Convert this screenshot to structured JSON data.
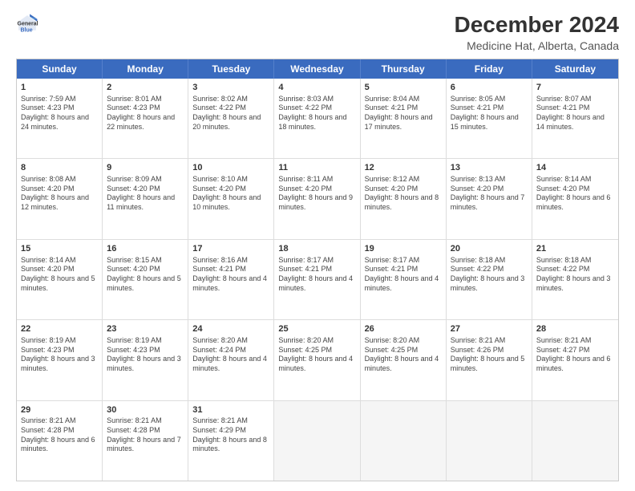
{
  "logo": {
    "line1": "General",
    "line2": "Blue"
  },
  "title": "December 2024",
  "subtitle": "Medicine Hat, Alberta, Canada",
  "days": [
    "Sunday",
    "Monday",
    "Tuesday",
    "Wednesday",
    "Thursday",
    "Friday",
    "Saturday"
  ],
  "weeks": [
    [
      {
        "num": "1",
        "sunrise": "Sunrise: 7:59 AM",
        "sunset": "Sunset: 4:23 PM",
        "daylight": "Daylight: 8 hours and 24 minutes."
      },
      {
        "num": "2",
        "sunrise": "Sunrise: 8:01 AM",
        "sunset": "Sunset: 4:23 PM",
        "daylight": "Daylight: 8 hours and 22 minutes."
      },
      {
        "num": "3",
        "sunrise": "Sunrise: 8:02 AM",
        "sunset": "Sunset: 4:22 PM",
        "daylight": "Daylight: 8 hours and 20 minutes."
      },
      {
        "num": "4",
        "sunrise": "Sunrise: 8:03 AM",
        "sunset": "Sunset: 4:22 PM",
        "daylight": "Daylight: 8 hours and 18 minutes."
      },
      {
        "num": "5",
        "sunrise": "Sunrise: 8:04 AM",
        "sunset": "Sunset: 4:21 PM",
        "daylight": "Daylight: 8 hours and 17 minutes."
      },
      {
        "num": "6",
        "sunrise": "Sunrise: 8:05 AM",
        "sunset": "Sunset: 4:21 PM",
        "daylight": "Daylight: 8 hours and 15 minutes."
      },
      {
        "num": "7",
        "sunrise": "Sunrise: 8:07 AM",
        "sunset": "Sunset: 4:21 PM",
        "daylight": "Daylight: 8 hours and 14 minutes."
      }
    ],
    [
      {
        "num": "8",
        "sunrise": "Sunrise: 8:08 AM",
        "sunset": "Sunset: 4:20 PM",
        "daylight": "Daylight: 8 hours and 12 minutes."
      },
      {
        "num": "9",
        "sunrise": "Sunrise: 8:09 AM",
        "sunset": "Sunset: 4:20 PM",
        "daylight": "Daylight: 8 hours and 11 minutes."
      },
      {
        "num": "10",
        "sunrise": "Sunrise: 8:10 AM",
        "sunset": "Sunset: 4:20 PM",
        "daylight": "Daylight: 8 hours and 10 minutes."
      },
      {
        "num": "11",
        "sunrise": "Sunrise: 8:11 AM",
        "sunset": "Sunset: 4:20 PM",
        "daylight": "Daylight: 8 hours and 9 minutes."
      },
      {
        "num": "12",
        "sunrise": "Sunrise: 8:12 AM",
        "sunset": "Sunset: 4:20 PM",
        "daylight": "Daylight: 8 hours and 8 minutes."
      },
      {
        "num": "13",
        "sunrise": "Sunrise: 8:13 AM",
        "sunset": "Sunset: 4:20 PM",
        "daylight": "Daylight: 8 hours and 7 minutes."
      },
      {
        "num": "14",
        "sunrise": "Sunrise: 8:14 AM",
        "sunset": "Sunset: 4:20 PM",
        "daylight": "Daylight: 8 hours and 6 minutes."
      }
    ],
    [
      {
        "num": "15",
        "sunrise": "Sunrise: 8:14 AM",
        "sunset": "Sunset: 4:20 PM",
        "daylight": "Daylight: 8 hours and 5 minutes."
      },
      {
        "num": "16",
        "sunrise": "Sunrise: 8:15 AM",
        "sunset": "Sunset: 4:20 PM",
        "daylight": "Daylight: 8 hours and 5 minutes."
      },
      {
        "num": "17",
        "sunrise": "Sunrise: 8:16 AM",
        "sunset": "Sunset: 4:21 PM",
        "daylight": "Daylight: 8 hours and 4 minutes."
      },
      {
        "num": "18",
        "sunrise": "Sunrise: 8:17 AM",
        "sunset": "Sunset: 4:21 PM",
        "daylight": "Daylight: 8 hours and 4 minutes."
      },
      {
        "num": "19",
        "sunrise": "Sunrise: 8:17 AM",
        "sunset": "Sunset: 4:21 PM",
        "daylight": "Daylight: 8 hours and 4 minutes."
      },
      {
        "num": "20",
        "sunrise": "Sunrise: 8:18 AM",
        "sunset": "Sunset: 4:22 PM",
        "daylight": "Daylight: 8 hours and 3 minutes."
      },
      {
        "num": "21",
        "sunrise": "Sunrise: 8:18 AM",
        "sunset": "Sunset: 4:22 PM",
        "daylight": "Daylight: 8 hours and 3 minutes."
      }
    ],
    [
      {
        "num": "22",
        "sunrise": "Sunrise: 8:19 AM",
        "sunset": "Sunset: 4:23 PM",
        "daylight": "Daylight: 8 hours and 3 minutes."
      },
      {
        "num": "23",
        "sunrise": "Sunrise: 8:19 AM",
        "sunset": "Sunset: 4:23 PM",
        "daylight": "Daylight: 8 hours and 3 minutes."
      },
      {
        "num": "24",
        "sunrise": "Sunrise: 8:20 AM",
        "sunset": "Sunset: 4:24 PM",
        "daylight": "Daylight: 8 hours and 4 minutes."
      },
      {
        "num": "25",
        "sunrise": "Sunrise: 8:20 AM",
        "sunset": "Sunset: 4:25 PM",
        "daylight": "Daylight: 8 hours and 4 minutes."
      },
      {
        "num": "26",
        "sunrise": "Sunrise: 8:20 AM",
        "sunset": "Sunset: 4:25 PM",
        "daylight": "Daylight: 8 hours and 4 minutes."
      },
      {
        "num": "27",
        "sunrise": "Sunrise: 8:21 AM",
        "sunset": "Sunset: 4:26 PM",
        "daylight": "Daylight: 8 hours and 5 minutes."
      },
      {
        "num": "28",
        "sunrise": "Sunrise: 8:21 AM",
        "sunset": "Sunset: 4:27 PM",
        "daylight": "Daylight: 8 hours and 6 minutes."
      }
    ],
    [
      {
        "num": "29",
        "sunrise": "Sunrise: 8:21 AM",
        "sunset": "Sunset: 4:28 PM",
        "daylight": "Daylight: 8 hours and 6 minutes."
      },
      {
        "num": "30",
        "sunrise": "Sunrise: 8:21 AM",
        "sunset": "Sunset: 4:28 PM",
        "daylight": "Daylight: 8 hours and 7 minutes."
      },
      {
        "num": "31",
        "sunrise": "Sunrise: 8:21 AM",
        "sunset": "Sunset: 4:29 PM",
        "daylight": "Daylight: 8 hours and 8 minutes."
      },
      null,
      null,
      null,
      null
    ]
  ]
}
